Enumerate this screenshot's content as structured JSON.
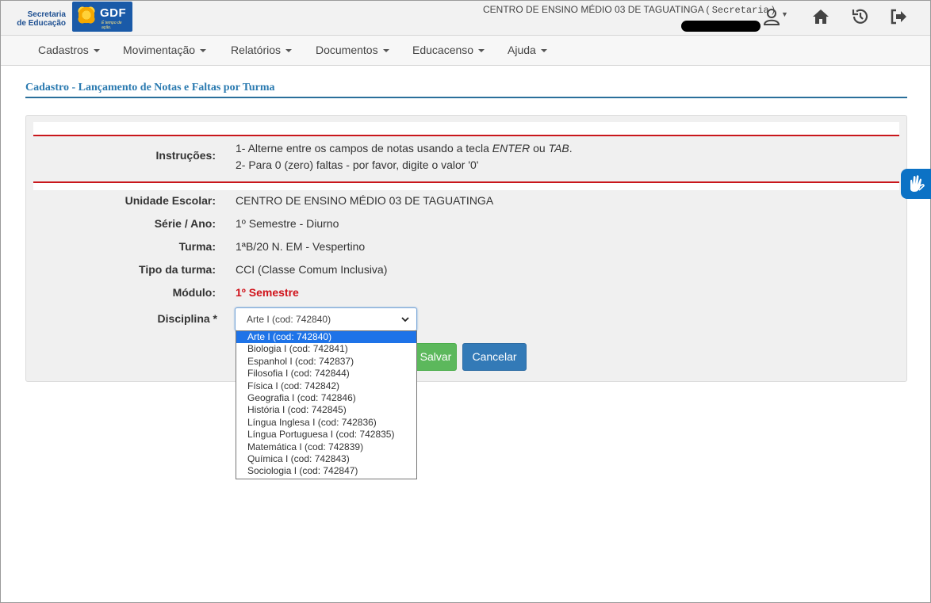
{
  "header": {
    "logo_secretaria": [
      "Secretaria",
      "de Educação"
    ],
    "logo_gdf": "GDF",
    "logo_gdf_tagline": "É tempo de ação.",
    "school": "CENTRO DE ENSINO MÉDIO 03 DE TAGUATINGA",
    "role_open": " ( ",
    "role": "Secretaria",
    "role_close": " )",
    "icons": [
      "user-icon",
      "home-icon",
      "history-icon",
      "exit-icon"
    ]
  },
  "nav": {
    "items": [
      "Cadastros",
      "Movimentação",
      "Relatórios",
      "Documentos",
      "Educacenso",
      "Ajuda"
    ]
  },
  "page": {
    "title": "Cadastro - Lançamento de Notas e Faltas por Turma"
  },
  "form": {
    "instr_label": "Instruções:",
    "instr_1_pre": "1- Alterne entre os campos de notas usando a tecla ",
    "instr_1_enter": "ENTER",
    "instr_1_mid": " ou ",
    "instr_1_tab": "TAB",
    "instr_1_end": ".",
    "instr_2": "2- Para 0 (zero) faltas - por favor, digite o valor '0'",
    "unidade_label": "Unidade Escolar:",
    "unidade_value": "CENTRO DE ENSINO MÉDIO 03 DE TAGUATINGA",
    "serie_label": "Série / Ano:",
    "serie_value": "1º Semestre - Diurno",
    "turma_label": "Turma:",
    "turma_value": "1ªB/20 N. EM - Vespertino",
    "tipo_label": "Tipo da turma:",
    "tipo_value": "CCI (Classe Comum Inclusiva)",
    "modulo_label": "Módulo:",
    "modulo_value": "1º Semestre",
    "disciplina_label": "Disciplina *",
    "disciplina_selected": "Arte I (cod: 742840)",
    "disciplina_options": [
      "Arte I (cod: 742840)",
      "Biologia I (cod: 742841)",
      "Espanhol I (cod: 742837)",
      "Filosofia I (cod: 742844)",
      "Física I (cod: 742842)",
      "Geografia I (cod: 742846)",
      "História I (cod: 742845)",
      "Língua Inglesa I (cod: 742836)",
      "Língua Portuguesa I (cod: 742835)",
      "Matemática I (cod: 742839)",
      "Química I (cod: 742843)",
      "Sociologia I (cod: 742847)"
    ],
    "save_label": "Salvar",
    "cancel_label": "Cancelar"
  },
  "colors": {
    "accent_blue": "#2a7ab0",
    "danger_red": "#c9161b",
    "save_green": "#5cb85c",
    "cancel_blue": "#337ab7",
    "selected_option": "#1e73e8"
  },
  "accessibility": {
    "icon": "sign-language-icon"
  }
}
